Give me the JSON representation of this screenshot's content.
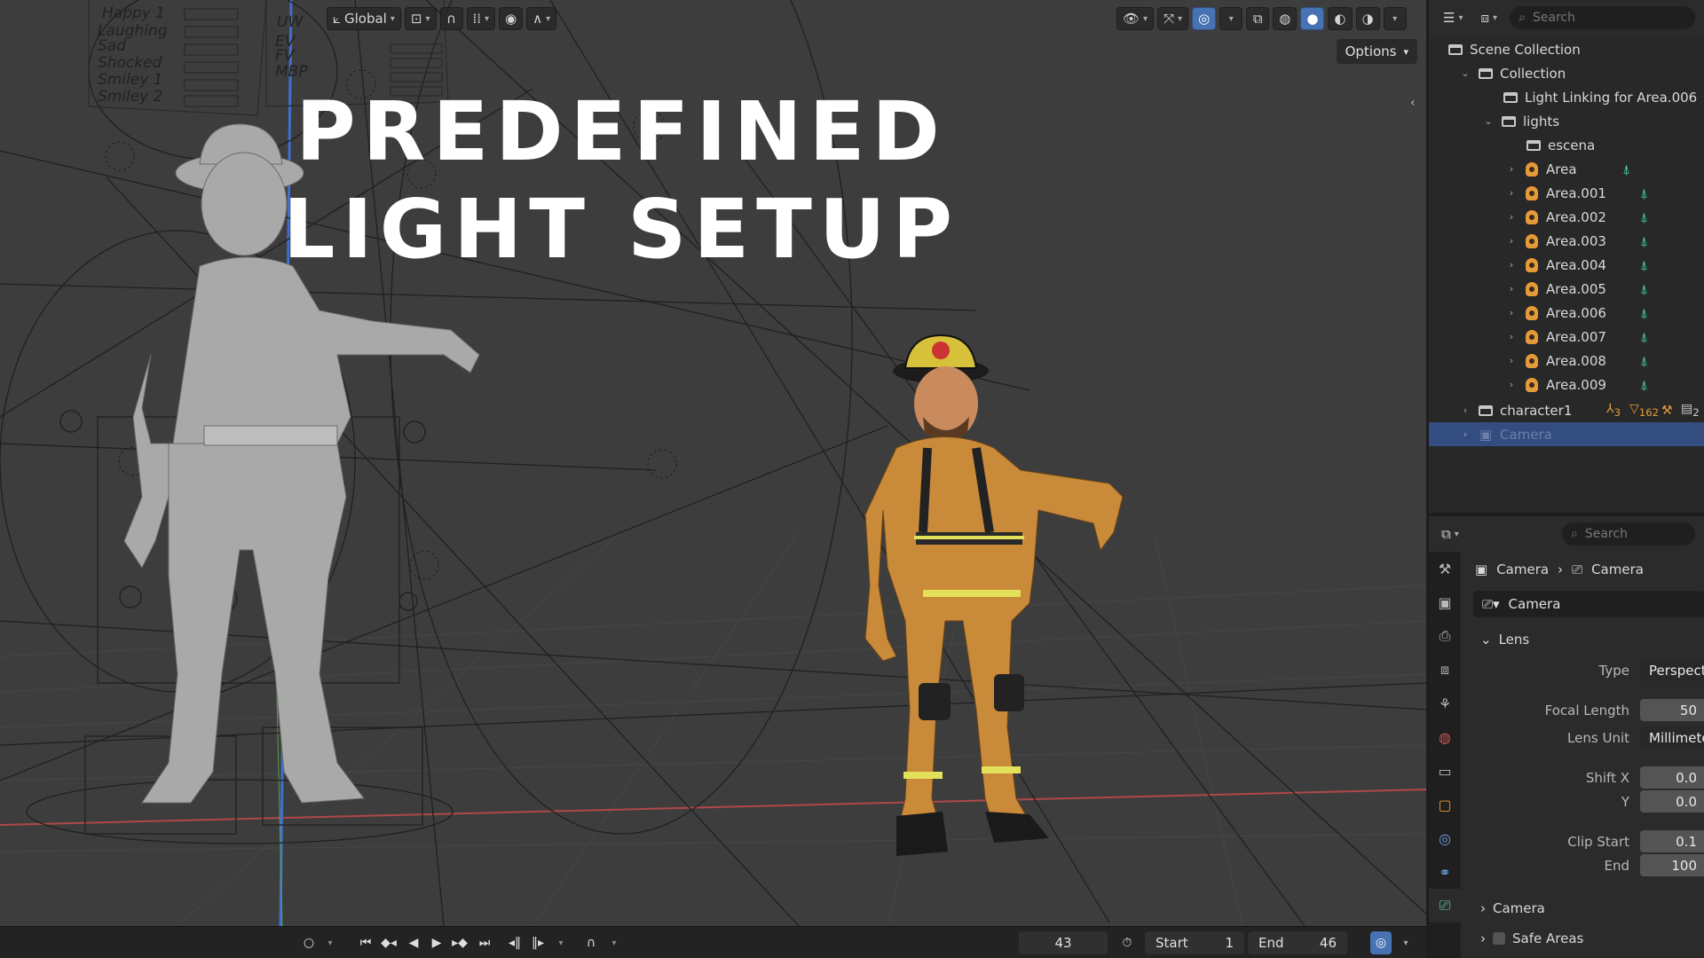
{
  "viewport": {
    "header": {
      "transform_orientation": "Global",
      "options_label": "Options"
    },
    "overlay_title": {
      "line1": "PREDEFINED",
      "line2": "LIGHT SETUP"
    },
    "rig_labels": [
      "Happy 1",
      "Laughing",
      "Sad",
      "Shocked",
      "Smiley 1",
      "Smiley 2"
    ],
    "rig_labels_right": [
      "UW",
      "EV",
      "FV",
      "MBP"
    ]
  },
  "timeline": {
    "current_frame": "43",
    "start_label": "Start",
    "start_value": "1",
    "end_label": "End",
    "end_value": "46"
  },
  "outliner": {
    "search_placeholder": "Search",
    "rows": [
      {
        "label": "Scene Collection",
        "icon": "scene-collection-icon"
      },
      {
        "label": "Collection",
        "icon": "collection-icon"
      },
      {
        "label": "Light Linking for Area.006",
        "icon": "collection-icon"
      },
      {
        "label": "lights",
        "icon": "collection-icon"
      },
      {
        "label": "escena",
        "icon": "collection-icon"
      },
      {
        "label": "Area",
        "icon": "light-icon"
      },
      {
        "label": "Area.001",
        "icon": "light-icon"
      },
      {
        "label": "Area.002",
        "icon": "light-icon"
      },
      {
        "label": "Area.003",
        "icon": "light-icon"
      },
      {
        "label": "Area.004",
        "icon": "light-icon"
      },
      {
        "label": "Area.005",
        "icon": "light-icon"
      },
      {
        "label": "Area.006",
        "icon": "light-icon"
      },
      {
        "label": "Area.007",
        "icon": "light-icon"
      },
      {
        "label": "Area.008",
        "icon": "light-icon"
      },
      {
        "label": "Area.009",
        "icon": "light-icon"
      },
      {
        "label": "character1",
        "icon": "collection-icon"
      },
      {
        "label": "Camera",
        "icon": "camera-icon"
      }
    ],
    "character_badges": [
      "3",
      "162",
      "2"
    ]
  },
  "properties": {
    "search_placeholder": "Search",
    "breadcrumb": [
      "Camera",
      "Camera"
    ],
    "data_name": "Camera",
    "lens_panel": "Lens",
    "fields": [
      {
        "label": "Type",
        "value": "Perspective"
      },
      {
        "label": "Focal Length",
        "value": "50"
      },
      {
        "label": "Lens Unit",
        "value": "Millimeters"
      },
      {
        "label": "Shift X",
        "value": "0.0"
      },
      {
        "label": "Y",
        "value": "0.0"
      },
      {
        "label": "Clip Start",
        "value": "0.1"
      },
      {
        "label": "End",
        "value": "100"
      }
    ],
    "subpanels": [
      "Camera",
      "Safe Areas"
    ]
  },
  "colors": {
    "viewport_bg": "#3d3d3d",
    "accent_blue": "#4772b3",
    "selection_blue": "#334d80",
    "light_icon": "#e59a3a",
    "data_green": "#4fd69c",
    "x_axis": "#c04444",
    "z_axis": "#3f6fd0"
  }
}
